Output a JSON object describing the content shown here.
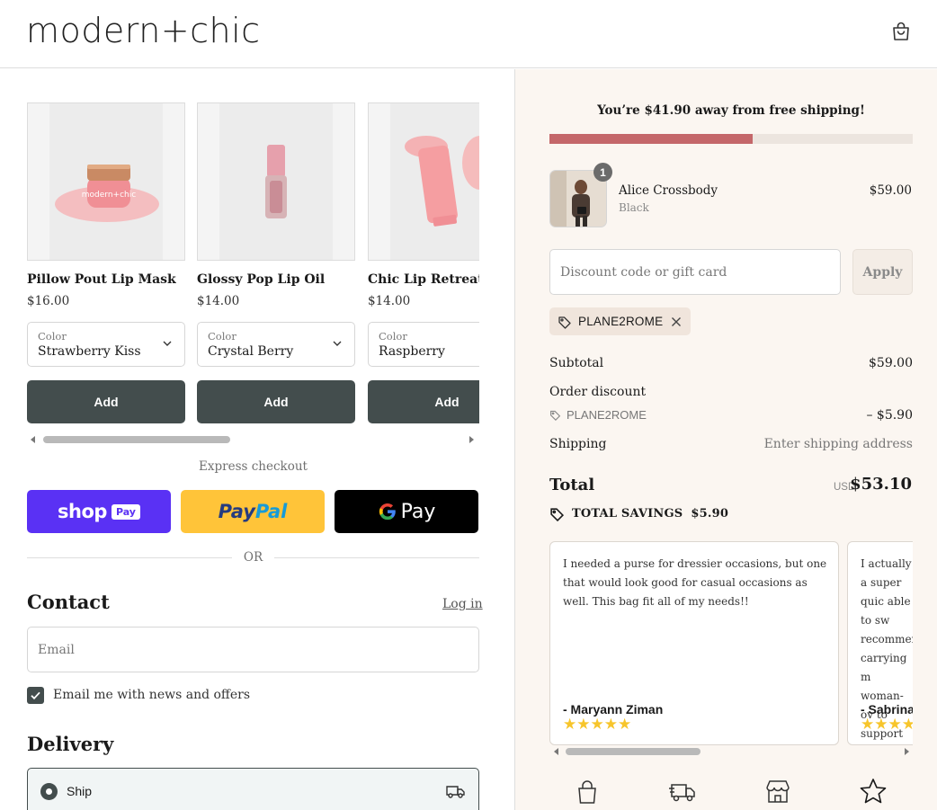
{
  "header": {
    "logo": "modern+chic",
    "cart_icon": "shopping-bag-icon"
  },
  "upsell": {
    "products": [
      {
        "name": "Pillow Pout Lip Mask",
        "price": "$16.00",
        "color_label": "Color",
        "color_value": "Strawberry Kiss",
        "add_label": "Add"
      },
      {
        "name": "Glossy Pop Lip Oil",
        "price": "$14.00",
        "color_label": "Color",
        "color_value": "Crystal Berry",
        "add_label": "Add"
      },
      {
        "name": "Chic Lip Retreat",
        "price": "$14.00",
        "color_label": "Color",
        "color_value": "Raspberry",
        "add_label": "Add"
      }
    ]
  },
  "express": {
    "title": "Express checkout",
    "shoppay": {
      "shop": "shop",
      "pay": "Pay"
    },
    "paypal": {
      "pay": "Pay",
      "pal": "Pal"
    },
    "gpay": {
      "g": "G",
      "pay": "Pay"
    },
    "or": "OR"
  },
  "contact": {
    "heading": "Contact",
    "login": "Log in",
    "email_placeholder": "Email",
    "newsletter_label": "Email me with news and offers",
    "newsletter_checked": true
  },
  "delivery": {
    "heading": "Delivery",
    "option_label": "Ship"
  },
  "summary": {
    "free_shipping_message": "You’re $41.90 away from free shipping!",
    "progress_fraction": 0.56,
    "progress_color": "#c4676a",
    "item": {
      "qty": "1",
      "name": "Alice Crossbody",
      "variant": "Black",
      "price": "$59.00"
    },
    "discount_placeholder": "Discount code or gift card",
    "apply_label": "Apply",
    "applied_code": "PLANE2ROME",
    "subtotal_label": "Subtotal",
    "subtotal_value": "$59.00",
    "order_discount_label": "Order discount",
    "order_discount_code": "PLANE2ROME",
    "order_discount_value": "– $5.90",
    "shipping_label": "Shipping",
    "shipping_value": "Enter shipping address",
    "total_label": "Total",
    "total_currency": "USD",
    "total_value": "$53.10",
    "savings_label": "TOTAL SAVINGS",
    "savings_value": "$5.90"
  },
  "reviews": [
    {
      "text": "I needed a purse for dressier occasions, but one that would look good for casual occasions as well. This bag fit all of my needs!!",
      "author": "- Maryann Ziman",
      "rating": 5
    },
    {
      "text": "I actually a super quic able to sw recommen carrying m woman-ov to support",
      "author": "- Sabrina",
      "rating": 5
    }
  ],
  "bottom_icons": [
    "lock-bag-icon",
    "delivery-truck-icon",
    "store-icon",
    "star-icon"
  ]
}
